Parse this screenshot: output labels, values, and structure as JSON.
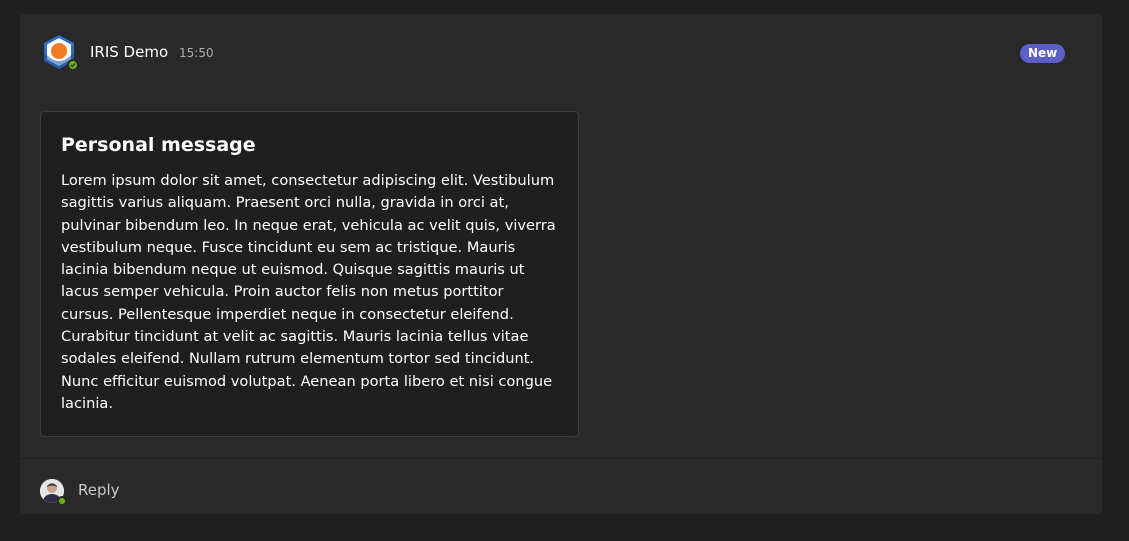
{
  "post": {
    "sender": "IRIS Demo",
    "time": "15:50",
    "badge": "New",
    "app_icon": "iris-bot-icon",
    "presence": "available"
  },
  "card": {
    "title": "Personal message",
    "body": "Lorem ipsum dolor sit amet, consectetur adipiscing elit. Vestibulum sagittis varius aliquam. Praesent orci nulla, gravida in orci at, pulvinar bibendum leo. In neque erat, vehicula ac velit quis, viverra vestibulum neque. Fusce tincidunt eu sem ac tristique. Mauris lacinia bibendum neque ut euismod. Quisque sagittis mauris ut lacus semper vehicula. Proin auctor felis non metus porttitor cursus. Pellentesque imperdiet neque in consectetur eleifend. Curabitur tincidunt at velit ac sagittis. Mauris lacinia tellus vitae sodales eleifend. Nullam rutrum elementum tortor sed tincidunt. Nunc efficitur euismod volutpat. Aenean porta libero et nisi congue lacinia."
  },
  "footer": {
    "reply_label": "Reply",
    "user_icon": "user-avatar-icon"
  },
  "colors": {
    "background": "#1f1f1f",
    "post_background": "#292929",
    "badge": "#5b5fc7",
    "presence_available": "#6bb700",
    "timestamp": "#adadad"
  }
}
